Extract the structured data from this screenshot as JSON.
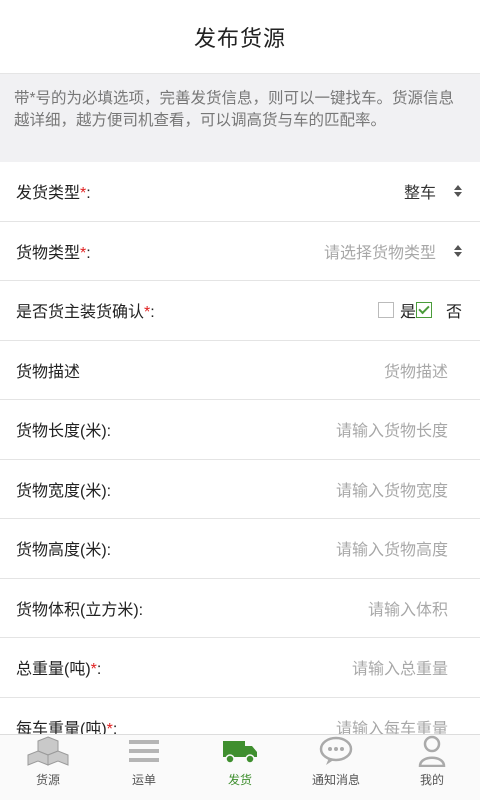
{
  "header": {
    "title": "发布货源"
  },
  "notice": {
    "text": "带*号的为必填选项，完善发货信息，则可以一键找车。货源信息越详细，越方便司机查看，可以调高货与车的匹配率。"
  },
  "form": {
    "required_mark": "*",
    "rows": [
      {
        "label": "发货类型",
        "required": true,
        "suffix": ":",
        "value": "整车"
      },
      {
        "label": "货物类型",
        "required": true,
        "suffix": ":",
        "placeholder": "请选择货物类型"
      },
      {
        "label": "是否货主装货确认",
        "required": true,
        "suffix": ":",
        "options": [
          "是",
          "否"
        ],
        "checked": "否"
      },
      {
        "label": "货物描述",
        "placeholder": "货物描述"
      },
      {
        "label": "货物长度(米):",
        "placeholder": "请输入货物长度"
      },
      {
        "label": "货物宽度(米):",
        "placeholder": "请输入货物宽度"
      },
      {
        "label": "货物高度(米):",
        "placeholder": "请输入货物高度"
      },
      {
        "label": "货物体积(立方米):",
        "placeholder": "请输入体积"
      },
      {
        "label": "总重量(吨)",
        "required": true,
        "suffix": ":",
        "placeholder": "请输入总重量"
      },
      {
        "label": "每车重量(吨)",
        "required": true,
        "suffix": ":",
        "placeholder": "请输入每车重量"
      }
    ]
  },
  "tabbar": {
    "active_color": "#3f8f2f",
    "items": [
      {
        "label": "货源",
        "icon": "boxes-icon"
      },
      {
        "label": "运单",
        "icon": "list-icon"
      },
      {
        "label": "发货",
        "icon": "truck-icon",
        "active": true
      },
      {
        "label": "通知消息",
        "icon": "chat-bubble-icon"
      },
      {
        "label": "我的",
        "icon": "person-icon"
      }
    ]
  }
}
